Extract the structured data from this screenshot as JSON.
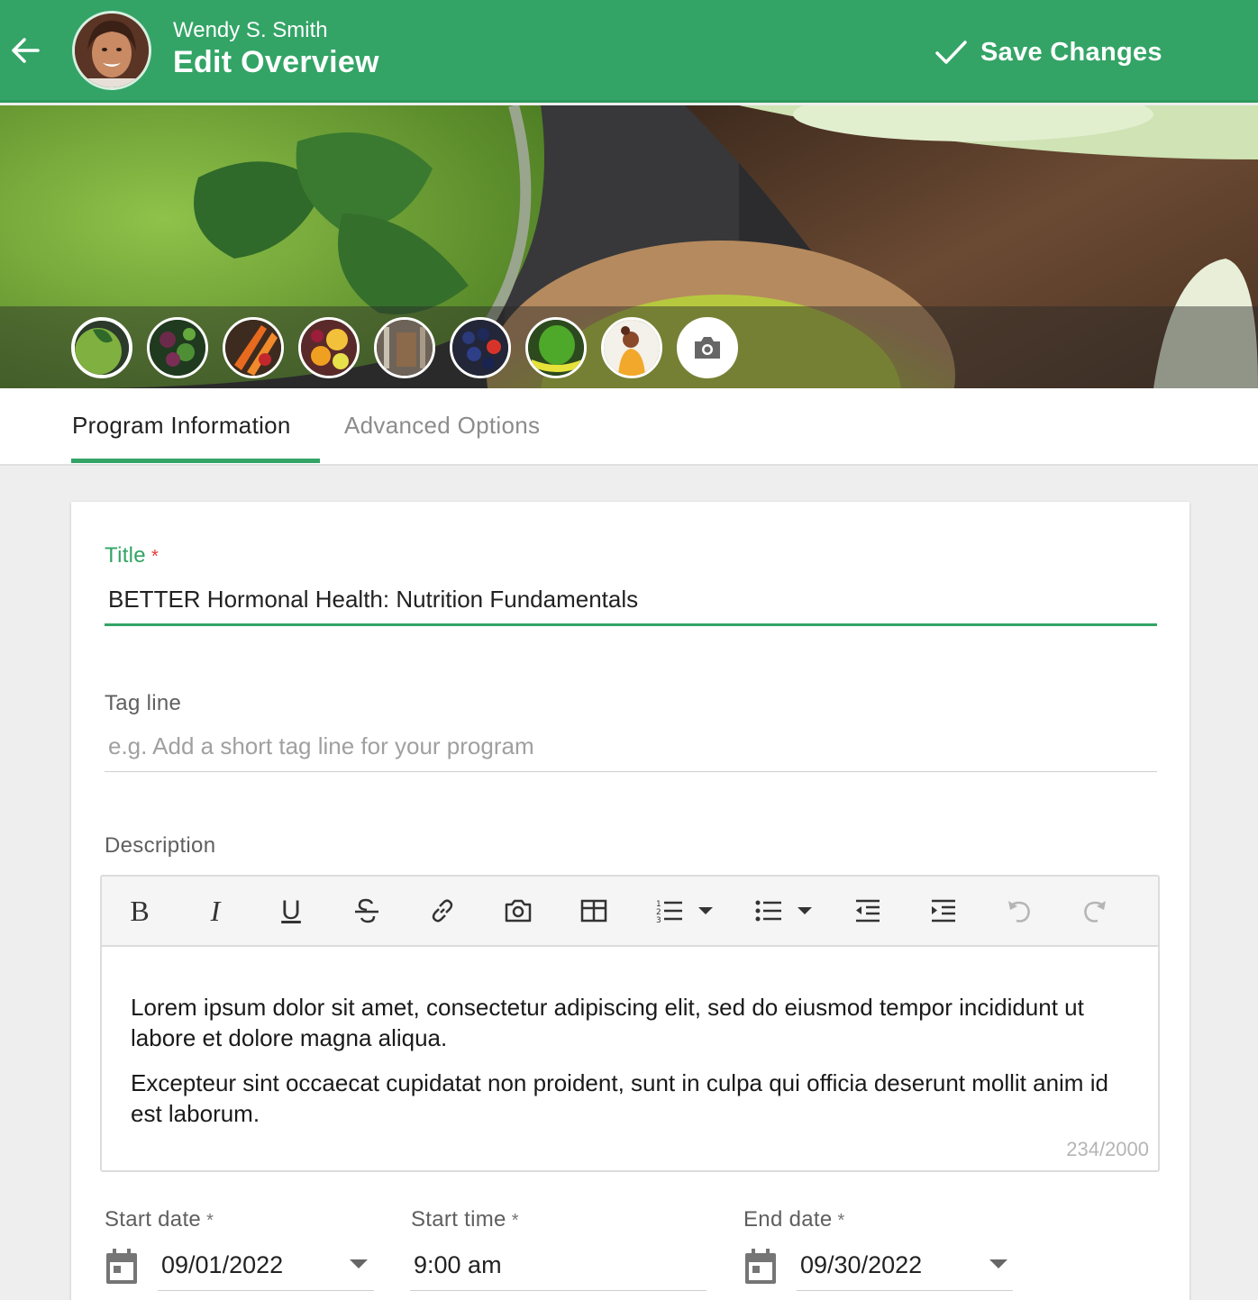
{
  "header": {
    "user_name": "Wendy S. Smith",
    "page_title": "Edit Overview",
    "save_label": "Save Changes",
    "bg_color": "#33a466"
  },
  "tabs": [
    {
      "label": "Program Information",
      "active": true
    },
    {
      "label": "Advanced Options",
      "active": false
    }
  ],
  "gallery": {
    "thumbnails": [
      "green-smoothie",
      "salad-greens",
      "carrots-vegetables",
      "citrus-fruits",
      "kitchen-tools",
      "berries",
      "avocado-measuring-tape",
      "fitness-woman"
    ],
    "selected_index": 0,
    "add_icon": "camera-icon"
  },
  "form": {
    "title": {
      "label": "Title",
      "required_mark": "*",
      "value": "BETTER Hormonal Health: Nutrition Fundamentals"
    },
    "tagline": {
      "label": "Tag line",
      "value": "",
      "placeholder": "e.g. Add a short tag line for your program"
    },
    "description": {
      "label": "Description",
      "toolbar": [
        "bold",
        "italic",
        "underline",
        "strikethrough",
        "link",
        "image",
        "table",
        "ordered-list",
        "bullet-list",
        "outdent",
        "indent",
        "undo",
        "redo"
      ],
      "bold_glyph": "B",
      "italic_glyph": "I",
      "underline_glyph": "U",
      "paragraphs": [
        "Lorem ipsum dolor sit amet, consectetur adipiscing elit, sed do eiusmod tempor incididunt ut labore et dolore magna aliqua.",
        "Excepteur sint occaecat cupidatat non proident, sunt in culpa qui officia deserunt mollit anim id est laborum."
      ],
      "counter": "234/2000"
    },
    "start_date": {
      "label": "Start date",
      "required_mark": "*",
      "value": "09/01/2022"
    },
    "start_time": {
      "label": "Start time",
      "required_mark": "*",
      "value": "9:00 am"
    },
    "end_date": {
      "label": "End date",
      "required_mark": "*",
      "value": "09/30/2022"
    }
  }
}
